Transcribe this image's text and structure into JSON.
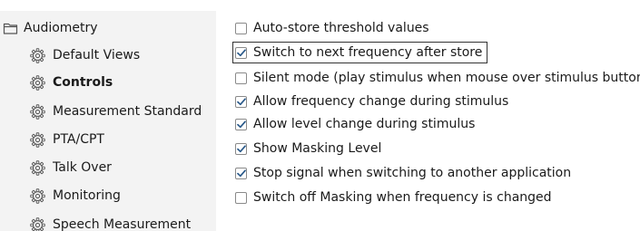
{
  "tree": {
    "root": {
      "label": "Audiometry",
      "icon": "folder-icon"
    },
    "items": [
      {
        "label": "Default Views",
        "icon": "gear-icon",
        "selected": false
      },
      {
        "label": "Controls",
        "icon": "gear-icon",
        "selected": true
      },
      {
        "label": "Measurement Standard",
        "icon": "gear-icon",
        "selected": false
      },
      {
        "label": "PTA/CPT",
        "icon": "gear-icon",
        "selected": false
      },
      {
        "label": "Talk Over",
        "icon": "gear-icon",
        "selected": false
      },
      {
        "label": "Monitoring",
        "icon": "gear-icon",
        "selected": false
      },
      {
        "label": "Speech Measurement",
        "icon": "gear-icon",
        "selected": false
      }
    ]
  },
  "options": [
    {
      "label": "Auto-store threshold values",
      "checked": false
    },
    {
      "label": "Switch to next frequency after store",
      "checked": true,
      "focused": true
    },
    {
      "label": "Silent mode (play stimulus when mouse over stimulus button)",
      "checked": false
    },
    {
      "label": "Allow frequency change during stimulus",
      "checked": true
    },
    {
      "label": "Allow level change during stimulus",
      "checked": true
    },
    {
      "label": "Show Masking Level",
      "checked": true
    },
    {
      "label": "Stop signal when switching to another application",
      "checked": true
    },
    {
      "label": "Switch off Masking when frequency is changed",
      "checked": false
    }
  ],
  "colors": {
    "sidebar_bg": "#f3f3f3",
    "check_mark": "#2b5a8a",
    "icon_gray": "#555555"
  }
}
